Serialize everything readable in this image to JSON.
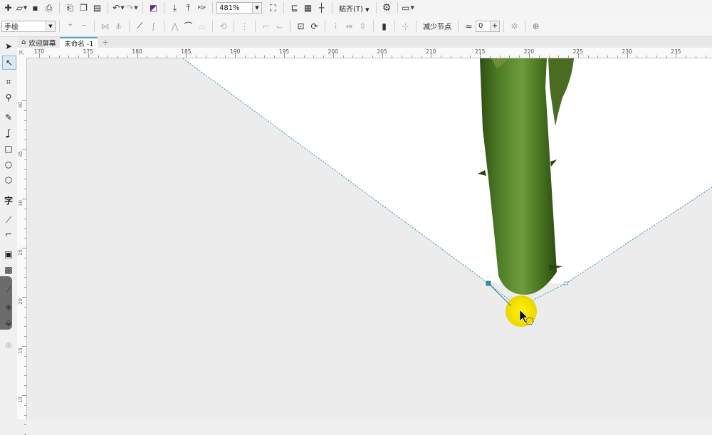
{
  "toolbar": {
    "zoom_value": "481%",
    "snap_label": "贴齐(T)",
    "pdf_label": "PDF"
  },
  "property_bar": {
    "mode_value": "手绘",
    "reduce_nodes_label": "减少节点",
    "smoothing_value": "0"
  },
  "tabs": [
    {
      "label": "欢迎屏幕"
    },
    {
      "label": "未命名 -1"
    }
  ],
  "ruler_h_labels": [
    "170",
    "175",
    "180",
    "185",
    "190",
    "195",
    "200",
    "205",
    "210",
    "215",
    "220",
    "225",
    "230",
    "235"
  ],
  "ruler_v_labels": [
    "40",
    "35",
    "30",
    "25",
    "20",
    "15",
    "10"
  ],
  "toolbox_icons": [
    "pick-tool-icon",
    "shape-tool-icon",
    "crop-tool-icon",
    "zoom-tool-icon",
    "freehand-tool-icon",
    "artistic-media-icon",
    "rectangle-tool-icon",
    "ellipse-tool-icon",
    "polygon-tool-icon",
    "text-tool-icon",
    "parallel-dimension-icon",
    "connector-tool-icon",
    "drop-shadow-icon",
    "transparency-icon",
    "eyedropper-icon",
    "interactive-fill-icon",
    "smart-fill-icon",
    "add-tool-icon"
  ],
  "colors": {
    "accent": "#48a7d8",
    "selection_line": "#3a8fb7",
    "stem_green": "#4d7a26",
    "highlight_yellow": "#f2e200"
  }
}
